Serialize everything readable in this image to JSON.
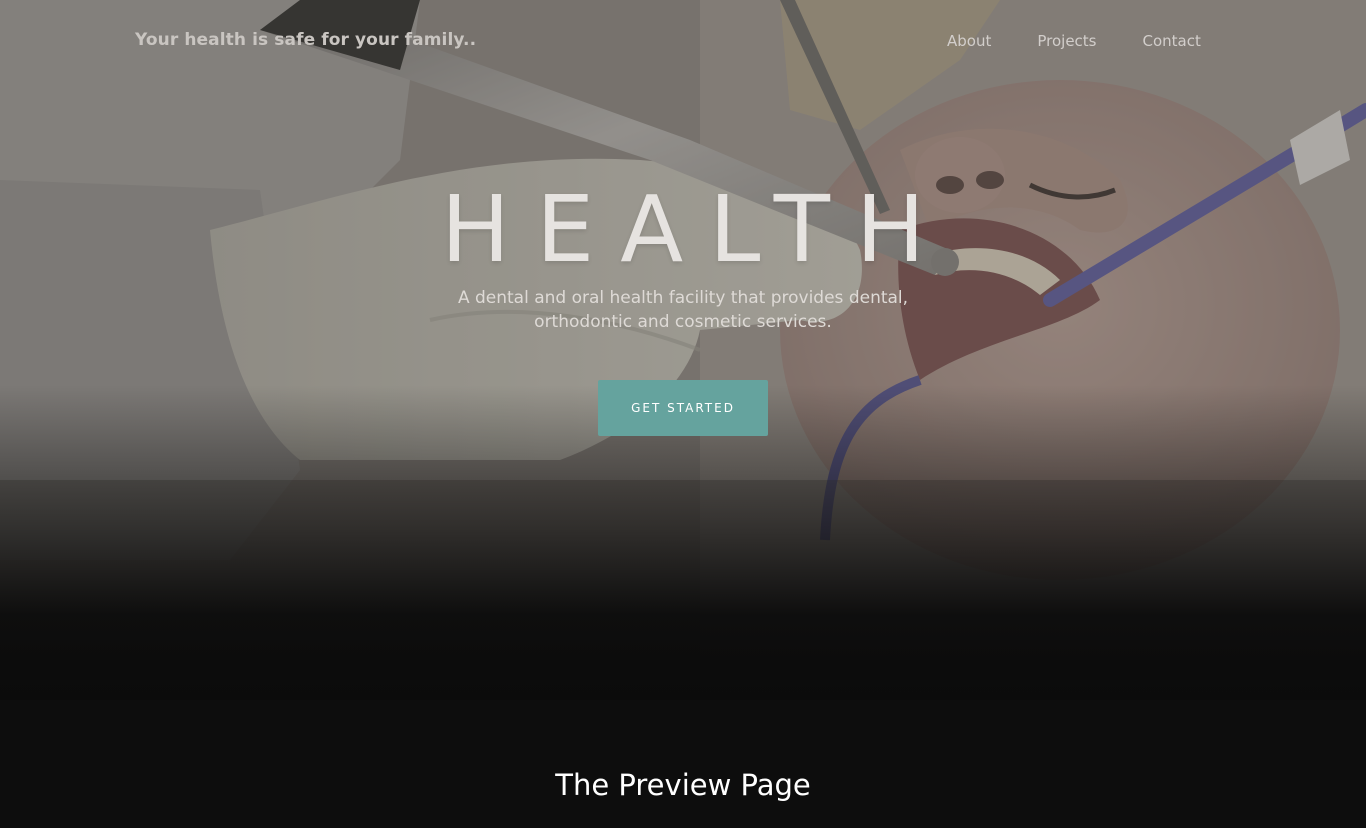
{
  "header": {
    "brand": "Your health is safe for your family..",
    "nav": [
      {
        "label": "About"
      },
      {
        "label": "Projects"
      },
      {
        "label": "Contact"
      }
    ]
  },
  "hero": {
    "title": "HEALTH",
    "subtitle": "A dental and oral health facility that provides dental, orthodontic and cosmetic services.",
    "cta_label": "GET STARTED",
    "background_image": "dentist-working-on-patient-photo"
  },
  "preview": {
    "title": "The Preview Page"
  },
  "colors": {
    "accent": "#65a39e",
    "dark_background": "#0d0d0d",
    "text_light": "#ffffff"
  }
}
